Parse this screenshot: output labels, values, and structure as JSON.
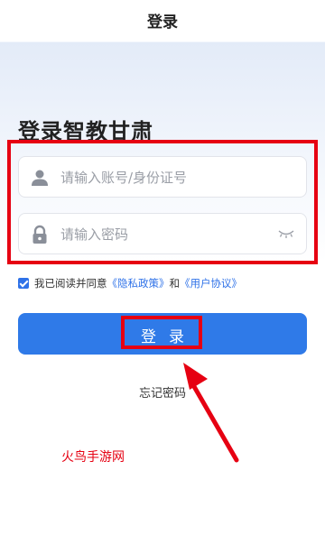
{
  "nav": {
    "title": "登录"
  },
  "page_title": "登录智教甘肃",
  "account_field": {
    "placeholder": "请输入账号/身份证号",
    "icon": "user-icon"
  },
  "password_field": {
    "placeholder": "请输入密码",
    "icon": "lock-icon",
    "toggle_icon": "eye-closed-icon"
  },
  "agreement": {
    "prefix": "我已阅读并同意",
    "privacy": "《隐私政策》",
    "and": "和",
    "terms": "《用户协议》",
    "checked": true
  },
  "login_button": {
    "label": "登录"
  },
  "forgot_password": "忘记密码",
  "watermark": "火鸟手游网",
  "colors": {
    "accent": "#2f7ae8",
    "annotation": "#e60012",
    "title": "#222222"
  }
}
